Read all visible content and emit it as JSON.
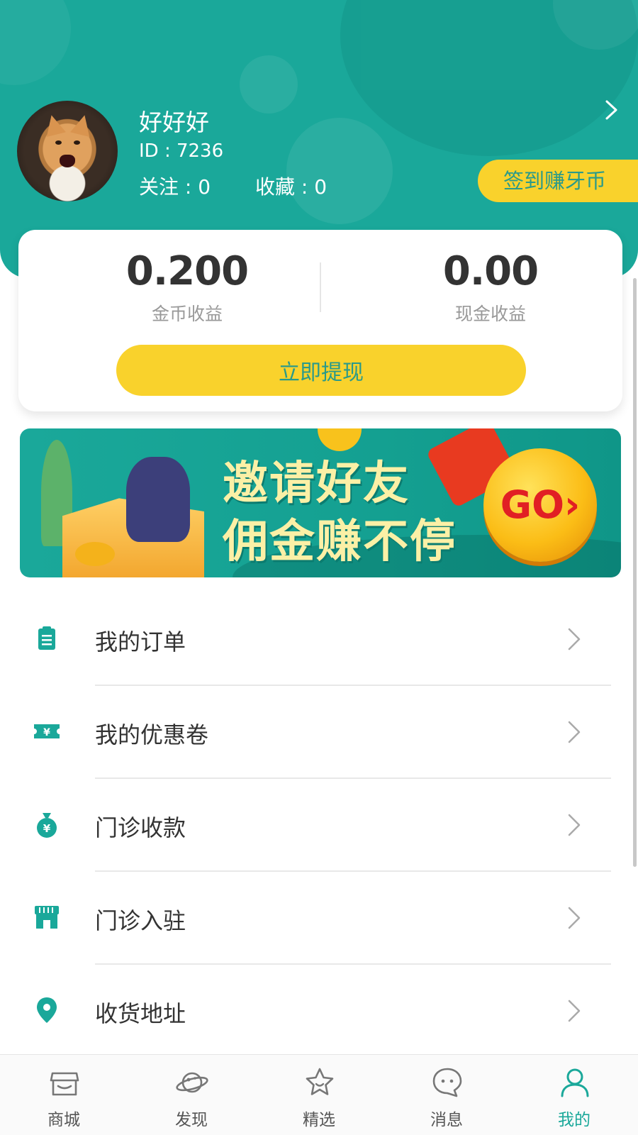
{
  "profile": {
    "nickname": "好好好",
    "id_text": "ID : 7236",
    "follow_text": "关注 : 0",
    "fav_text": "收藏 : 0",
    "avatar_icon": "cat-avatar"
  },
  "checkin": {
    "label": "签到赚牙币"
  },
  "earnings": {
    "coin_value": "0.200",
    "coin_label": "金币收益",
    "cash_value": "0.00",
    "cash_label": "现金收益",
    "withdraw_label": "立即提现"
  },
  "banner": {
    "line1": "邀请好友",
    "line2": "佣金赚不停",
    "go_label": "GO›"
  },
  "menu": [
    {
      "label": "我的订单",
      "icon": "clipboard-icon"
    },
    {
      "label": "我的优惠卷",
      "icon": "coupon-icon"
    },
    {
      "label": "门诊收款",
      "icon": "money-bag-icon"
    },
    {
      "label": "门诊入驻",
      "icon": "storefront-icon"
    },
    {
      "label": "收货地址",
      "icon": "location-pin-icon"
    }
  ],
  "tabs": [
    {
      "label": "商城",
      "icon": "shop-icon",
      "active": false
    },
    {
      "label": "发现",
      "icon": "planet-icon",
      "active": false
    },
    {
      "label": "精选",
      "icon": "star-icon",
      "active": false
    },
    {
      "label": "消息",
      "icon": "chat-bubble-icon",
      "active": false
    },
    {
      "label": "我的",
      "icon": "person-icon",
      "active": true
    }
  ],
  "colors": {
    "brand_teal": "#1aa89a",
    "accent_yellow": "#f9d22c",
    "text_dark": "#333333",
    "text_muted": "#999999"
  }
}
